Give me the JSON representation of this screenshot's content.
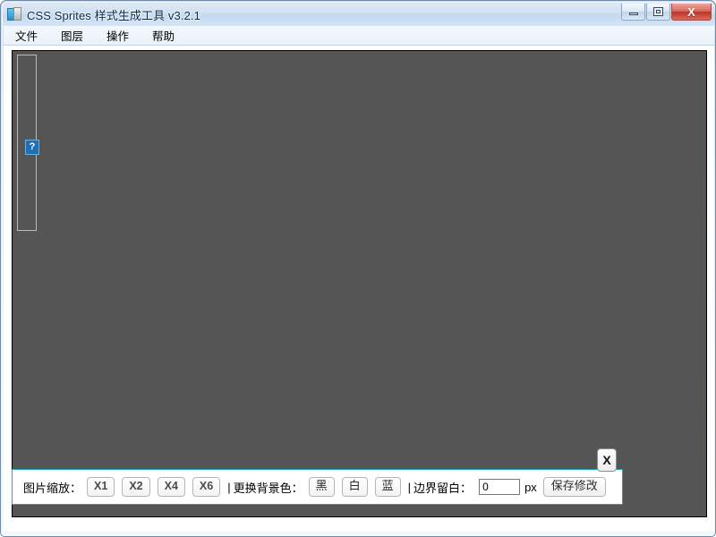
{
  "window": {
    "title": "CSS Sprites 样式生成工具 v3.2.1",
    "app_icon": "sprite-app-icon",
    "caption": {
      "minimize_label": "最小化",
      "maximize_label": "最大化",
      "close_label": "X"
    }
  },
  "menubar": {
    "items": [
      {
        "label": "文件",
        "name": "menu-file"
      },
      {
        "label": "图层",
        "name": "menu-layer"
      },
      {
        "label": "操作",
        "name": "menu-action"
      },
      {
        "label": "帮助",
        "name": "menu-help"
      }
    ]
  },
  "canvas": {
    "background_color": "#555555",
    "border_color": "#000000",
    "sprite_strip": {
      "name": "sprite-strip",
      "border_color": "#b9b9b9"
    },
    "broken_image": {
      "icon": "broken-image-icon",
      "glyph": "?",
      "color": "#1f6fb5"
    }
  },
  "options_panel": {
    "accent_color": "#17a9bf",
    "zoom_label": "图片缩放：",
    "zoom_buttons": [
      {
        "label": "X1",
        "name": "zoom-x1-button"
      },
      {
        "label": "X2",
        "name": "zoom-x2-button"
      },
      {
        "label": "X4",
        "name": "zoom-x4-button"
      },
      {
        "label": "X6",
        "name": "zoom-x6-button"
      }
    ],
    "separator_1": "|",
    "bgcolor_label": "更换背景色：",
    "bgcolor_buttons": [
      {
        "label": "黑",
        "name": "bgcolor-black-button"
      },
      {
        "label": "白",
        "name": "bgcolor-white-button"
      },
      {
        "label": "蓝",
        "name": "bgcolor-blue-button"
      }
    ],
    "separator_2": "|",
    "padding_label": "边界留白：",
    "padding_value": "0",
    "padding_placeholder": "0",
    "padding_unit": "px",
    "save_label": "保存修改",
    "close_label": "X"
  }
}
